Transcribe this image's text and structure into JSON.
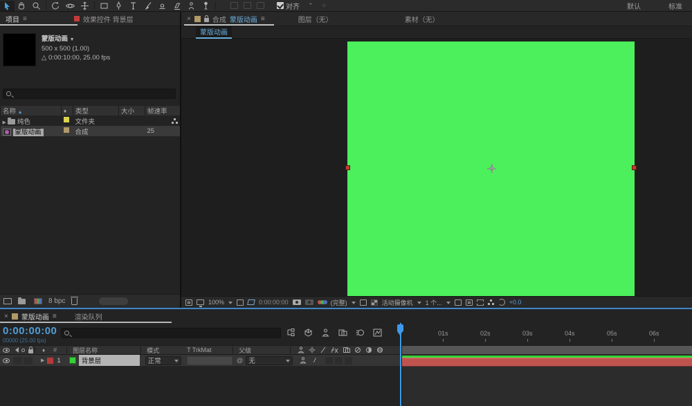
{
  "toolbar": {
    "tools": [
      "selection",
      "hand",
      "zoom",
      "rotation",
      "camera",
      "pan-behind",
      "shape",
      "pen",
      "type",
      "brush",
      "clone-stamp",
      "eraser",
      "roto-brush",
      "puppet-pin"
    ],
    "align_label": "对齐",
    "workspace": {
      "default_label": "默认",
      "standard_label": "标准"
    }
  },
  "project_panel": {
    "tabs": {
      "project": "项目",
      "effect_controls": "效果控件 背景层"
    },
    "preview": {
      "name": "蒙版动画",
      "caret": "▼",
      "size": "500 x 500 (1.00)",
      "duration": "△ 0:00:10:00, 25.00 fps"
    },
    "search_placeholder": "",
    "table": {
      "columns": [
        "名称",
        "类型",
        "大小",
        "帧速率"
      ],
      "rows": [
        {
          "name": "纯色",
          "type": "文件夹",
          "size": "",
          "frame_rate": ""
        },
        {
          "name": "蒙版动画",
          "type": "合成",
          "size": "",
          "frame_rate": "25"
        }
      ]
    },
    "footer": {
      "bpc": "8 bpc"
    }
  },
  "viewer": {
    "tabs": {
      "close": "×",
      "comp_prefix": "合成",
      "comp_name": "蒙版动画",
      "menu": "≡",
      "layer": "图层（无）",
      "footage": "素材（无）"
    },
    "breadcrumb": "蒙版动画",
    "toolbar": {
      "zoom": "100%",
      "timecode": "0:00:00:00",
      "resolution": "(完整)",
      "camera_view": "活动摄像机",
      "view_layout": "1 个...",
      "exposure": "+0.0"
    }
  },
  "timeline": {
    "tabs": {
      "comp": "蒙版动画",
      "render_queue": "渲染队列",
      "close": "×",
      "menu": "≡"
    },
    "timecode": "0:00:00:00",
    "frame_info": "00000 (25.00 fps)",
    "columns": {
      "layer_name": "图层名称",
      "mode": "模式",
      "trkmat": "T TrkMat",
      "parent": "父级"
    },
    "layer": {
      "index": "1",
      "name": "背景层",
      "mode": "正常",
      "pickwhip": "@",
      "parent": "无"
    },
    "ruler": [
      "01s",
      "02s",
      "03s",
      "04s",
      "05s",
      "06s"
    ]
  },
  "colors": {
    "accent_blue": "#4e9fd9",
    "comp_green": "#4bf05c",
    "cache_green": "#35d435",
    "layer_bar_red": "#bf544e",
    "label_red": "#b53a3a",
    "label_green": "#39cf39",
    "label_tan": "#b19a68",
    "label_yellow": "#d9d34f"
  }
}
